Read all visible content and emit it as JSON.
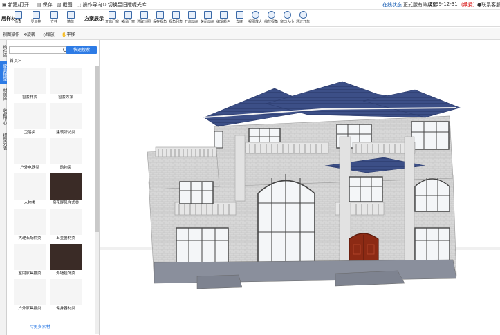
{
  "menu": {
    "items": [
      {
        "glyph": "▣",
        "label": "新建/打开"
      },
      {
        "glyph": "▤",
        "label": "保存"
      },
      {
        "glyph": "▧",
        "label": "截图"
      },
      {
        "glyph": "⬚",
        "label": "操作导向"
      },
      {
        "glyph": "↻",
        "label": "切换至旧版呢光库"
      }
    ],
    "online_status": "在线状态",
    "license": "正式版有效期至",
    "expiry": "2099-12-31",
    "renew": "(续费)",
    "contact": "联系客服"
  },
  "ribbon": {
    "group_left": "居样材料",
    "group_mid": "方案展示",
    "left_tools": [
      "场景",
      "罗马柱",
      "立柱",
      "墙体"
    ],
    "right_tools": [
      "开启门窗",
      "关闭门窗",
      "选取对照",
      "保存视角",
      "视角列表",
      "开启动画",
      "关闭动画",
      "编辑颜色",
      "去底",
      "视图放大",
      "缩放视角",
      "窗口大小",
      "通过开车"
    ]
  },
  "viewbar": {
    "mode": "视图操作",
    "items": [
      "旋转",
      "缩放",
      "平移"
    ]
  },
  "vtabs": [
    "构件库",
    "家具模型",
    "材质库",
    "收藏中心",
    "模型列表"
  ],
  "panel": {
    "search_placeholder": "",
    "quick_button": "快速搜索",
    "breadcrumb": "首页>",
    "items": [
      "窗套样式",
      "窗套方案",
      "卫浴类",
      "建筑牌坊类",
      "户外电器类",
      "动物类",
      "人物类",
      "窗花屏风样式类",
      "大理石配件类",
      "五金器材类",
      "室内家具摆类",
      "外墙挂饰类",
      "户外家具摆类",
      "健身器材类"
    ],
    "more": "▽更多素材"
  }
}
